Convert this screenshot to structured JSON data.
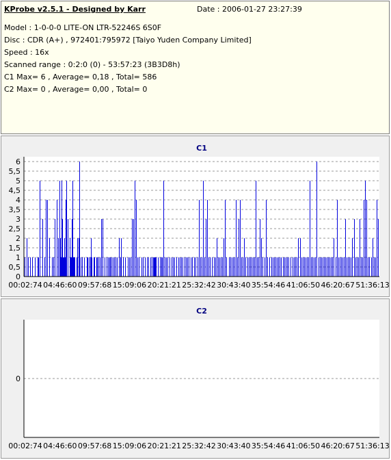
{
  "header": {
    "title": "KProbe v2.5.1 - Designed by Karr",
    "date": "Date : 2006-01-27 23:27:39",
    "lines": [
      "Model : 1-0-0-0 LITE-ON LTR-52246S      6S0F",
      "Disc : CDR (A+) , 972401:795972 [Taiyo Yuden Company Limited]",
      "Speed : 16x",
      "Scanned range : 0:2:0 (0) - 53:57:23 (3B3D8h)",
      "C1 Max= 6 , Average= 0,18 , Total= 586",
      "C2 Max= 0 , Average= 0,00 , Total= 0"
    ]
  },
  "colors": {
    "bar": "#0000dd",
    "grid": "#9a9a9a",
    "title": "#000080",
    "panel": "#f0f0f0",
    "info": "#ffffee"
  },
  "chart_data": [
    {
      "type": "bar",
      "title": "C1",
      "xlabel": "",
      "ylabel": "",
      "ylim": [
        0,
        6.25
      ],
      "xlim": [
        0,
        1000
      ],
      "x_units": "per-mille of scanned range (0:02:74 to 53:57:23)",
      "yticks": [
        "0",
        "0,5",
        "1",
        "1,5",
        "2",
        "2,5",
        "3",
        "3,5",
        "4",
        "4,5",
        "5",
        "5,5",
        "6"
      ],
      "xticks": [
        "00:02:74",
        "04:46:60",
        "09:57:68",
        "15:09:06",
        "20:21:21",
        "25:32:42",
        "30:43:40",
        "35:54:46",
        "41:06:50",
        "46:20:67",
        "51:36:13"
      ],
      "grid": true,
      "x": [
        2,
        7,
        12,
        18,
        24,
        30,
        38,
        40,
        44,
        52,
        58,
        62,
        66,
        72,
        78,
        82,
        86,
        92,
        96,
        100,
        102,
        104,
        106,
        108,
        110,
        112,
        114,
        116,
        118,
        120,
        124,
        128,
        130,
        132,
        134,
        136,
        138,
        140,
        142,
        148,
        150,
        154,
        156,
        160,
        164,
        170,
        176,
        178,
        182,
        186,
        188,
        190,
        196,
        198,
        204,
        206,
        210,
        214,
        218,
        222,
        226,
        232,
        236,
        240,
        242,
        246,
        250,
        254,
        258,
        262,
        268,
        272,
        274,
        278,
        284,
        292,
        296,
        300,
        304,
        308,
        312,
        316,
        320,
        324,
        330,
        334,
        340,
        346,
        350,
        356,
        360,
        364,
        366,
        368,
        370,
        372,
        376,
        382,
        386,
        388,
        392,
        396,
        400,
        404,
        410,
        416,
        420,
        424,
        428,
        434,
        438,
        442,
        446,
        452,
        456,
        460,
        464,
        470,
        474,
        478,
        482,
        488,
        492,
        496,
        500,
        504,
        508,
        512,
        516,
        520,
        524,
        528,
        534,
        538,
        542,
        546,
        550,
        554,
        558,
        562,
        566,
        570,
        576,
        580,
        584,
        588,
        592,
        596,
        600,
        604,
        608,
        612,
        616,
        620,
        624,
        628,
        632,
        636,
        640,
        644,
        648,
        652,
        656,
        660,
        664,
        668,
        672,
        676,
        680,
        684,
        690,
        696,
        700,
        704,
        708,
        712,
        716,
        720,
        724,
        728,
        732,
        736,
        740,
        744,
        750,
        756,
        760,
        764,
        768,
        772,
        776,
        780,
        784,
        788,
        792,
        796,
        800,
        804,
        808,
        812,
        816,
        820,
        824,
        828,
        832,
        836,
        840,
        844,
        848,
        852,
        856,
        860,
        864,
        868,
        872,
        876,
        880,
        884,
        888,
        892,
        896,
        900,
        904,
        908,
        912,
        916,
        920,
        924,
        928,
        932,
        936,
        940,
        944,
        948,
        952,
        956,
        960,
        964,
        968,
        972,
        976,
        980,
        984,
        988,
        992,
        996
      ],
      "values": [
        1,
        2,
        1,
        1,
        1,
        1,
        1,
        1,
        5,
        3,
        1,
        4,
        4,
        2,
        1,
        1,
        3,
        4,
        2,
        5,
        2,
        1,
        5,
        3,
        1,
        1,
        2,
        1,
        4,
        5,
        3,
        2,
        1,
        1,
        3,
        5,
        1,
        1,
        1,
        1,
        2,
        2,
        6,
        1,
        1,
        1,
        1,
        1,
        1,
        1,
        2,
        1,
        1,
        1,
        1,
        1,
        1,
        1,
        3,
        3,
        1,
        1,
        1,
        1,
        1,
        1,
        1,
        1,
        1,
        1,
        2,
        1,
        2,
        1,
        1,
        1,
        1,
        1,
        3,
        3,
        5,
        4,
        1,
        1,
        1,
        1,
        1,
        1,
        1,
        1,
        1,
        1,
        1,
        1,
        1,
        1,
        1,
        1,
        1,
        1,
        5,
        1,
        1,
        1,
        1,
        1,
        1,
        1,
        1,
        1,
        1,
        1,
        1,
        1,
        1,
        1,
        1,
        1,
        1,
        1,
        1,
        1,
        4,
        1,
        1,
        5,
        1,
        3,
        4,
        1,
        1,
        1,
        1,
        1,
        2,
        1,
        1,
        1,
        1,
        2,
        4,
        1,
        1,
        1,
        1,
        1,
        1,
        4,
        1,
        3,
        4,
        1,
        1,
        2,
        1,
        1,
        1,
        1,
        1,
        1,
        1,
        5,
        1,
        1,
        3,
        2,
        1,
        1,
        4,
        1,
        1,
        1,
        1,
        1,
        1,
        1,
        1,
        1,
        1,
        1,
        1,
        1,
        1,
        1,
        1,
        1,
        1,
        1,
        1,
        2,
        2,
        1,
        1,
        1,
        1,
        1,
        1,
        5,
        1,
        1,
        1,
        1,
        6,
        1,
        1,
        1,
        1,
        1,
        1,
        1,
        1,
        1,
        1,
        1,
        2,
        1,
        4,
        1,
        1,
        1,
        1,
        1,
        3,
        1,
        1,
        1,
        1,
        2,
        3,
        1,
        1,
        1,
        3,
        1,
        1,
        4,
        5,
        4,
        1,
        1,
        1,
        2,
        1,
        1,
        4,
        3,
        1,
        1,
        1,
        1,
        4,
        1
      ]
    },
    {
      "type": "bar",
      "title": "C2",
      "xlabel": "",
      "ylabel": "",
      "ylim": [
        -1,
        1
      ],
      "xlim": [
        0,
        1000
      ],
      "x_units": "per-mille of scanned range (0:02:74 to 53:57:23)",
      "yticks": [
        "0"
      ],
      "xticks": [
        "00:02:74",
        "04:46:60",
        "09:57:68",
        "15:09:06",
        "20:21:21",
        "25:32:42",
        "30:43:40",
        "35:54:46",
        "41:06:50",
        "46:20:67",
        "51:36:13"
      ],
      "grid": true,
      "x": [],
      "values": []
    }
  ]
}
